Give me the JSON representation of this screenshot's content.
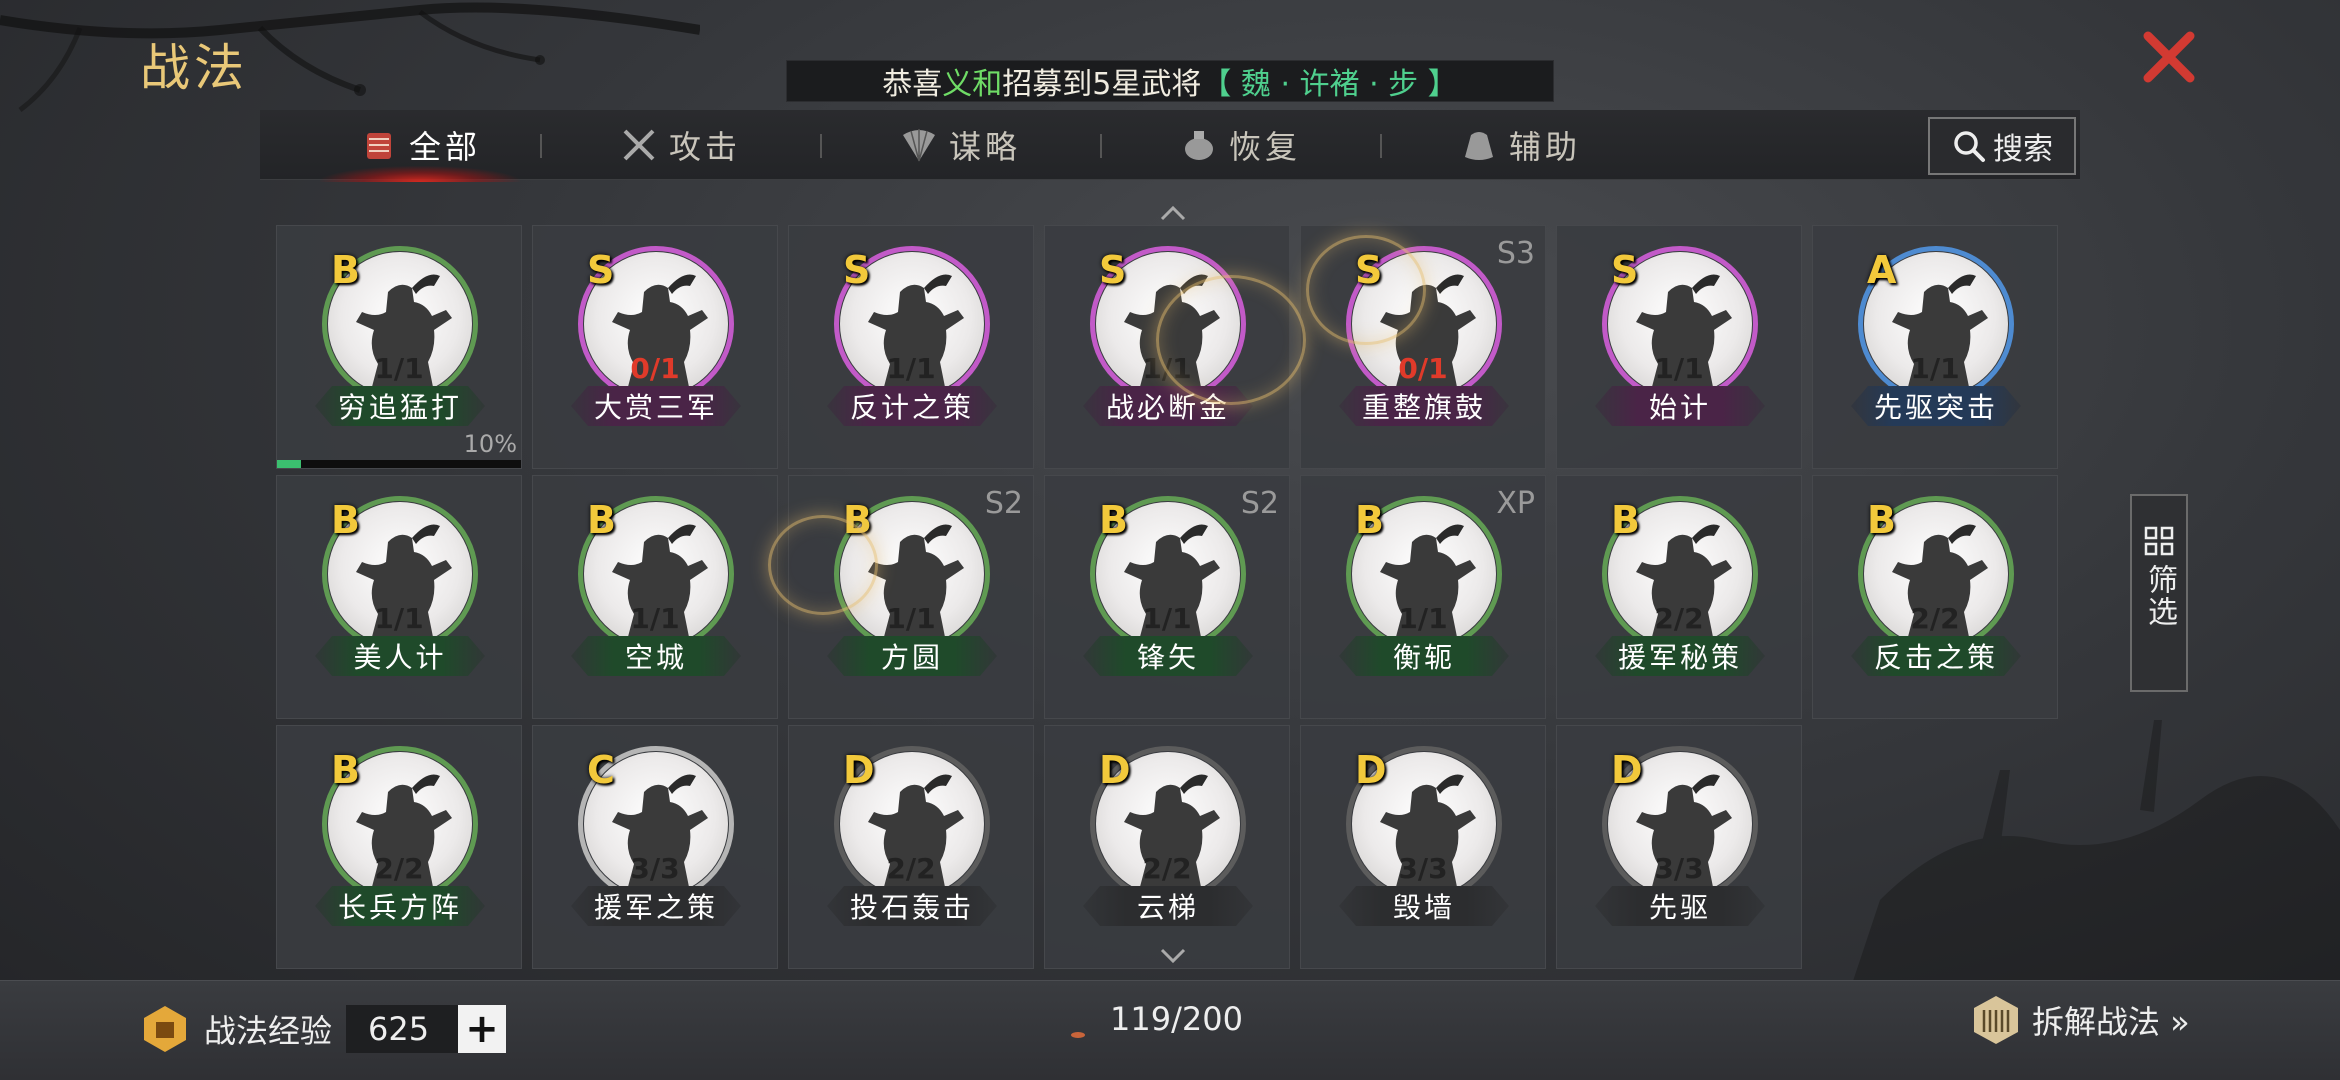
{
  "header": {
    "title": "战法",
    "marquee": {
      "prefix": "恭喜",
      "player": "义和",
      "middle": "招募到5星武将",
      "hero": "【 魏 · 许褚 · 步 】"
    }
  },
  "tabs": [
    {
      "label": "全部",
      "icon": "all-scroll-icon",
      "active": true
    },
    {
      "label": "攻击",
      "icon": "crossed-swords-icon",
      "active": false
    },
    {
      "label": "谋略",
      "icon": "fan-icon",
      "active": false
    },
    {
      "label": "恢复",
      "icon": "medicine-icon",
      "active": false
    },
    {
      "label": "辅助",
      "icon": "pouch-icon",
      "active": false
    }
  ],
  "search": {
    "label": "搜索",
    "icon": "search-icon"
  },
  "filter": {
    "label": "筛选",
    "icon": "grid-icon"
  },
  "skills": [
    {
      "grade": "B",
      "name": "穷追猛打",
      "count": "1/1",
      "count_red": false,
      "season": "",
      "progress": 0.1,
      "progress_text": "10%"
    },
    {
      "grade": "S",
      "name": "大赏三军",
      "count": "0/1",
      "count_red": true,
      "season": ""
    },
    {
      "grade": "S",
      "name": "反计之策",
      "count": "1/1",
      "count_red": false,
      "season": ""
    },
    {
      "grade": "S",
      "name": "战必断金",
      "count": "1/1",
      "count_red": false,
      "season": ""
    },
    {
      "grade": "S",
      "name": "重整旗鼓",
      "count": "0/1",
      "count_red": true,
      "season": "S3"
    },
    {
      "grade": "S",
      "name": "始计",
      "count": "1/1",
      "count_red": false,
      "season": ""
    },
    {
      "grade": "A",
      "name": "先驱突击",
      "count": "1/1",
      "count_red": false,
      "season": ""
    },
    {
      "grade": "B",
      "name": "美人计",
      "count": "1/1",
      "count_red": false,
      "season": ""
    },
    {
      "grade": "B",
      "name": "空城",
      "count": "1/1",
      "count_red": false,
      "season": ""
    },
    {
      "grade": "B",
      "name": "方圆",
      "count": "1/1",
      "count_red": false,
      "season": "S2"
    },
    {
      "grade": "B",
      "name": "锋矢",
      "count": "1/1",
      "count_red": false,
      "season": "S2"
    },
    {
      "grade": "B",
      "name": "衡轭",
      "count": "1/1",
      "count_red": false,
      "season": "XP"
    },
    {
      "grade": "B",
      "name": "援军秘策",
      "count": "2/2",
      "count_red": false,
      "season": ""
    },
    {
      "grade": "B",
      "name": "反击之策",
      "count": "2/2",
      "count_red": false,
      "season": ""
    },
    {
      "grade": "B",
      "name": "长兵方阵",
      "count": "2/2",
      "count_red": false,
      "season": ""
    },
    {
      "grade": "C",
      "name": "援军之策",
      "count": "3/3",
      "count_red": false,
      "season": ""
    },
    {
      "grade": "D",
      "name": "投石轰击",
      "count": "2/2",
      "count_red": false,
      "season": ""
    },
    {
      "grade": "D",
      "name": "云梯",
      "count": "2/2",
      "count_red": false,
      "season": ""
    },
    {
      "grade": "D",
      "name": "毁墙",
      "count": "3/3",
      "count_red": false,
      "season": ""
    },
    {
      "grade": "D",
      "name": "先驱",
      "count": "3/3",
      "count_red": false,
      "season": ""
    }
  ],
  "footer": {
    "exp_label": "战法经验",
    "exp_value": "625",
    "capacity": "119/200",
    "dismantle_label": "拆解战法 »"
  },
  "colors": {
    "gold_title": "#e9c878",
    "grade_text": "#f2c93b",
    "ring_S": "#c25ac8",
    "ring_A": "#4e8bd1",
    "ring_B": "#5f9a52",
    "ring_C": "#b5b5b5",
    "ring_D": "#5c5c5c",
    "close_red": "#d23a32"
  }
}
